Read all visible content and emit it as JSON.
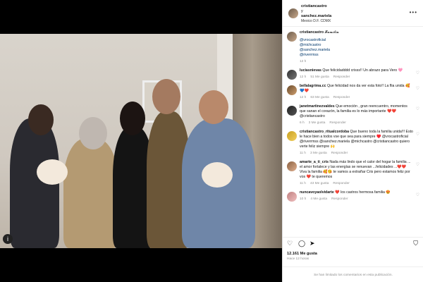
{
  "post_header": {
    "author": "cristiancastro",
    "connector": "y",
    "coauthor": "sanchez.mariela",
    "location": "Mexico D.F. CDMX"
  },
  "caption": {
    "username": "cristiancastro",
    "text": "𝓕𝓪𝓶𝓲𝓵𝓲𝓪",
    "mentions": [
      "@vrocastroficial",
      "@michcastro",
      "@sanchez.mariela",
      "@riverrmss"
    ],
    "time": "12 h"
  },
  "comments": [
    {
      "username": "luciasnievas",
      "text": "Que felicidadddd crisss!! Un abrazo para Vero 🩷",
      "time": "12 h",
      "likes": "51 Me gusta",
      "reply": "Responder"
    },
    {
      "username": "bellalagrima.cc",
      "text": "Que felicidad nos da ver esta foto!! La flia unida 🥰💙❤️",
      "time": "12 h",
      "likes": "63 Me gusta",
      "reply": "Responder"
    },
    {
      "username": "janetmartinezvaldes",
      "text": "Que emoción , gran reencuentro, momentos que sanan el corazón, la familia es lo más importante ❤️❤️ @cristiancastro",
      "time": "6 h",
      "likes": "3 Me gusta",
      "reply": "Responder"
    },
    {
      "username": "cristiancastro_ritualcordoba",
      "text": "Que bueno toda la familia unida!!! Esto le hace bien a todos vse que sea para siempre ♥️ @vrocastroficial @riverrmss @sanchez.mariela @michcastro @cristiancastro quiero verte feliz siempre 🙌",
      "time": "11 h",
      "likes": "3 Me gusta",
      "reply": "Responder"
    },
    {
      "username": "amarte_a_ti_cris",
      "text": "Nada más lindo que el calor del hogar la familia ... el amor fortalece y las energías se renuevan ...felicidades ...❤️❤️ Viva la familia 🥰😘 te vamos a extrañar Cris pero estamos feliz por vos ❤️ te queremos",
      "time": "11 h",
      "likes": "43 Me gusta",
      "reply": "Responder"
    },
    {
      "username": "nuncavoyaolvidarte",
      "text": "❤️ los castros hermosa familia 😍",
      "time": "10 h",
      "likes": "4 Me gusta",
      "reply": "Responder"
    }
  ],
  "footer": {
    "likes": "12.161 Me gusta",
    "time": "Hace 12 horas",
    "limited": "Se han limitado los comentarios en esta publicación."
  },
  "icons": {
    "heart": "heart-icon",
    "comment": "comment-icon",
    "share": "share-icon",
    "save": "bookmark-icon",
    "more": "more-icon"
  }
}
